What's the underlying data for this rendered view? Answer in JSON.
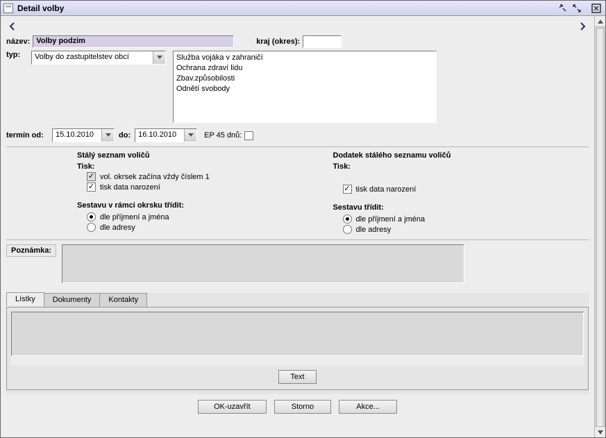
{
  "window": {
    "title": "Detail volby"
  },
  "form": {
    "name_label": "název:",
    "name_value": "Volby podzim",
    "region_label": "kraj (okres):",
    "region_value": "",
    "type_label": "typ:",
    "type_value": "Volby do zastupitelstev obcí",
    "reasons": [
      "Služba vojáka v zahraničí",
      "Ochrana zdraví lidu",
      "Zbav.způsobilosti",
      "Odnětí svobody"
    ],
    "term_from_label": "termín od:",
    "term_from_value": "15.10.2010",
    "term_to_label": "do:",
    "term_to_value": "16.10.2010",
    "ep_label": "EP 45 dnů:"
  },
  "left_col": {
    "heading": "Stálý seznam voličů",
    "tisk_label": "Tisk:",
    "chk1_label": "vol. okrsek začína vždy číslem 1",
    "chk2_label": "tisk data narození",
    "sort_heading": "Sestavu v rámci okrsku třídit:",
    "radio1_label": "dle příjmení a jména",
    "radio2_label": "dle adresy"
  },
  "right_col": {
    "heading": "Dodatek stálého seznamu voličů",
    "tisk_label": "Tisk:",
    "chk2_label": "tisk data narození",
    "sort_heading": "Sestavu třídit:",
    "radio1_label": "dle příjmení a jména",
    "radio2_label": "dle adresy"
  },
  "note": {
    "label": "Poznámka:",
    "value": ""
  },
  "tabs": {
    "items": [
      "Lístky",
      "Dokumenty",
      "Kontakty"
    ],
    "text_btn": "Text"
  },
  "buttons": {
    "ok": "OK-uzavřít",
    "cancel": "Storno",
    "actions": "Akce..."
  }
}
